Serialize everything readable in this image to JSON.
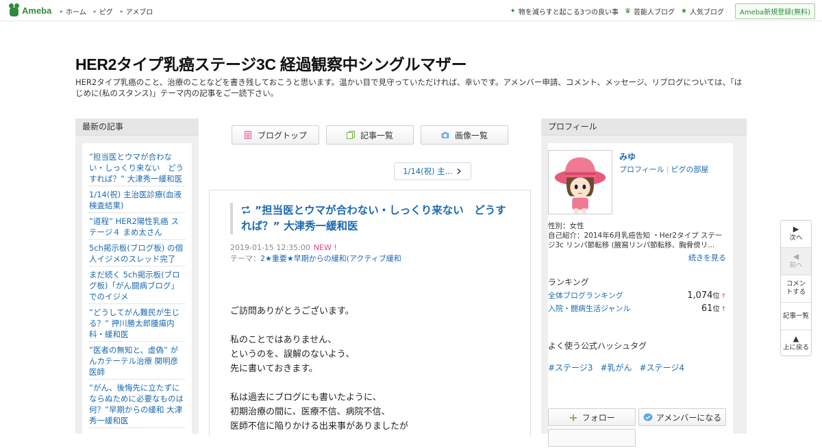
{
  "global_header": {
    "logo_text": "Ameba",
    "nav": [
      "ホーム",
      "ピグ",
      "アメブロ"
    ],
    "links": [
      {
        "icon": "sparkle-icon",
        "label": "物を減らすと起こる3つの良い事"
      },
      {
        "icon": "crown-icon",
        "label": "芸能人ブログ"
      },
      {
        "icon": "star-icon",
        "label": "人気ブログ"
      }
    ],
    "register_label": "Ameba新規登録(無料)"
  },
  "blog": {
    "title": "HER2タイプ乳癌ステージ3C 経過観察中シングルマザー",
    "description": "HER2タイプ乳癌のこと、治療のことなどを書き残しておこうと思います。温かい目で見守っていただければ、幸いです。アメンバー申請、コメント、メッセージ、リブログについては、「はじめに(私のスタンス)」テーマ内の記事をご一読下さい。"
  },
  "left_sidebar": {
    "heading": "最新の記事",
    "items": [
      "”担当医とウマが合わない・しっくり来ない　どうすれば？” 大津秀一緩和医",
      "1/14(祝) 主治医診療(血液検査結果)",
      "”道程” HER2陽性乳癌 ステージ４ まめ太さん",
      "5ch掲示板(ブログ板) の個人イジメのスレッド完了",
      "まだ続く 5ch掲示板(ブログ板)「がん闘病ブログ」でのイジメ",
      "”どうしてがん難民が生じる？” 押川勝太郎腫瘍内科・緩和医",
      "”医者の無知と、虚偽” がんカテーテル治療 関明彦医師",
      "”がん、後悔先に立たずにならぬために必要なものは何？”早期からの緩和 大津秀一緩和医"
    ]
  },
  "center": {
    "buttons": {
      "top": "ブログトップ",
      "list": "記事一覧",
      "images": "画像一覧"
    },
    "pager_label": "1/14(祝) 主...",
    "article": {
      "title": "”担当医とウマが合わない・しっくり来ない　どうすれば？” 大津秀一緩和医",
      "date": "2019-01-15 12:35:00",
      "new_badge": "NEW !",
      "theme_label": "テーマ：",
      "theme": "2★重要★早期からの緩和(アクティブ緩和",
      "paragraphs": [
        [
          "ご訪問ありがとうございます。"
        ],
        [
          "私のことではありません、",
          "というのを、誤解のないよう、",
          "先に書いておきます。"
        ],
        [
          "私は過去にブログにも書いたように、",
          "初期治療の間に、医療不信、病院不信、",
          "医師不信に陥りかける出来事がありましたが"
        ]
      ]
    }
  },
  "profile": {
    "heading": "プロフィール",
    "name": "みゆ",
    "link_profile": "プロフィール",
    "link_room": "ピグの部屋",
    "gender": "性別：女性",
    "intro": "自己紹介：2014年6月乳癌告知 ・Her2タイプ ステージ3c リンパ節転移 (腋窩リンパ節転移、胸骨傍リ...",
    "more": "続きを見る",
    "ranking_heading": "ランキング",
    "ranking": [
      {
        "label": "全体ブログランキング",
        "value": "1,074",
        "unit": "位",
        "trend": "↑"
      },
      {
        "label": "入院・闘病生活ジャンル",
        "value": "61",
        "unit": "位",
        "trend": "↑"
      }
    ],
    "hashtag_heading": "よく使う公式ハッシュタグ",
    "hashtags": [
      "#ステージ3",
      "#乳がん",
      "#ステージ4"
    ],
    "follow_label": "フォロー",
    "amember_label": "アメンバーになる"
  },
  "float_nav": {
    "next": "次へ",
    "prev": "前へ",
    "comment": "コメントする",
    "list": "記事一覧",
    "top": "上に戻る"
  },
  "colors": {
    "link": "#1a6ab2",
    "brand_green": "#2d8c3c",
    "new_badge": "#e83e8c"
  }
}
